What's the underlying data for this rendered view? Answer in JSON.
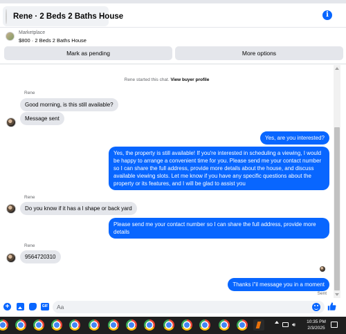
{
  "header": {
    "title": "Rene · 2 Beds 2 Baths House",
    "info_icon": "info-icon",
    "accent": "#0866ff"
  },
  "listing": {
    "category": "Marketplace",
    "description": "$800 · 2 Beds 2 Baths House"
  },
  "actions": {
    "pending_label": "Mark as pending",
    "more_label": "More options"
  },
  "chat": {
    "system_prefix": "Rene started this chat.",
    "system_link": "View buyer profile",
    "messages": [
      {
        "from": "Rene",
        "sender_label": "Rene",
        "text": "Good morning, is this still available?"
      },
      {
        "from": "Rene",
        "text": "Message sent"
      },
      {
        "from": "me",
        "text": "Yes, are you interested?"
      },
      {
        "from": "me",
        "text": "Yes, the property is still available! If you're interested in scheduling a viewing, I would be happy to arrange a convenient time for you. Please send me your contact number so I can share the full address, provide more details about the house, and discuss available viewing slots. Let me know if you have any specific questions about the property or its features, and I will be glad to assist you"
      },
      {
        "from": "Rene",
        "sender_label": "Rene",
        "text": "Do you know if it has a l shape or back yard"
      },
      {
        "from": "me",
        "text": "Please send me your contact number so I can share the full address, provide more details"
      },
      {
        "from": "Rene",
        "sender_label": "Rene",
        "text": "9564720310"
      },
      {
        "from": "me",
        "text": "Thanks i\"il message you in a moment"
      }
    ],
    "status": "Sent"
  },
  "composer": {
    "placeholder": "Aa",
    "icons": [
      "plus-icon",
      "photo-icon",
      "sticker-icon",
      "gif-icon",
      "emoji-icon",
      "like-icon"
    ],
    "gif_label": "GIF"
  },
  "taskbar": {
    "time": "10:35 PM",
    "date": "2/3/2025"
  }
}
